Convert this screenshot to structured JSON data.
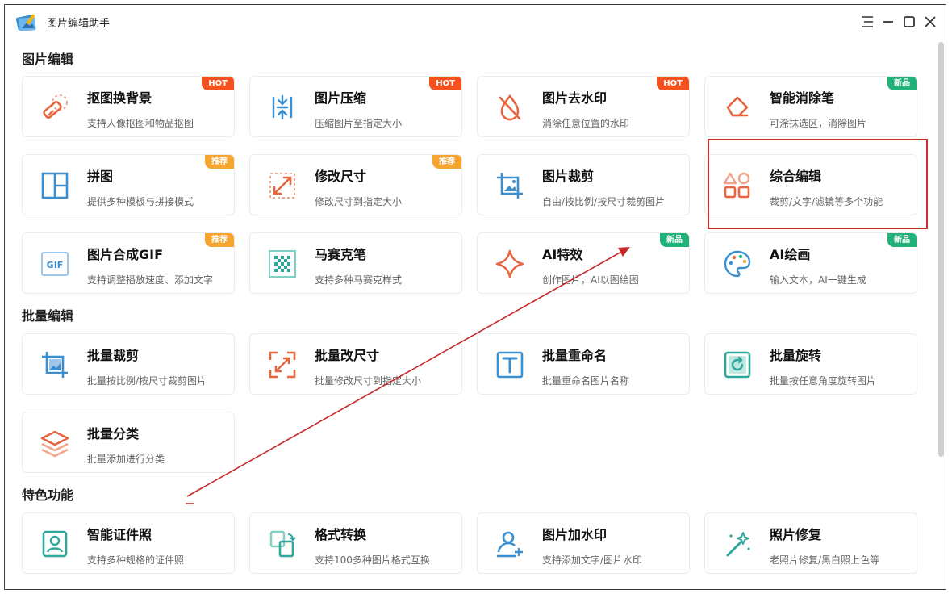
{
  "app": {
    "title": "图片编辑助手",
    "colors": {
      "hot": "#f4511e",
      "recommend": "#f6a531",
      "new": "#21b27a",
      "icon_orange": "#e8663f",
      "icon_blue": "#3a8fd0"
    }
  },
  "sections": {
    "edit": "图片编辑",
    "batch": "批量编辑",
    "feature": "特色功能"
  },
  "cards": [
    {
      "title": "抠图换背景",
      "desc": "支持人像抠图和物品抠图",
      "badge": "HOT",
      "icon": "eraser-icon"
    },
    {
      "title": "图片压缩",
      "desc": "压缩图片至指定大小",
      "badge": "HOT",
      "icon": "compress-icon"
    },
    {
      "title": "图片去水印",
      "desc": "消除任意位置的水印",
      "badge": "HOT",
      "icon": "droplet-off-icon"
    },
    {
      "title": "智能消除笔",
      "desc": "可涂抹选区，消除图片",
      "badge": "新品",
      "icon": "eraser-pen-icon"
    },
    {
      "title": "拼图",
      "desc": "提供多种模板与拼接模式",
      "badge": "推荐",
      "icon": "collage-icon"
    },
    {
      "title": "修改尺寸",
      "desc": "修改尺寸到指定大小",
      "badge": "推荐",
      "icon": "resize-icon"
    },
    {
      "title": "图片裁剪",
      "desc": "自由/按比例/按尺寸裁剪图片",
      "badge": "",
      "icon": "crop-icon"
    },
    {
      "title": "综合编辑",
      "desc": "裁剪/文字/滤镜等多个功能",
      "badge": "",
      "icon": "shapes-icon"
    },
    {
      "title": "图片合成GIF",
      "desc": "支持调整播放速度、添加文字",
      "badge": "推荐",
      "icon": "gif-icon"
    },
    {
      "title": "马赛克笔",
      "desc": "支持多种马赛克样式",
      "badge": "",
      "icon": "mosaic-icon"
    },
    {
      "title": "AI特效",
      "desc": "创作图片，AI以图绘图",
      "badge": "新品",
      "icon": "sparkle-icon"
    },
    {
      "title": "AI绘画",
      "desc": "输入文本，AI一键生成",
      "badge": "新品",
      "icon": "palette-icon"
    },
    {
      "title": "批量裁剪",
      "desc": "批量按比例/按尺寸裁剪图片",
      "badge": "",
      "icon": "batch-crop-icon"
    },
    {
      "title": "批量改尺寸",
      "desc": "批量修改尺寸到指定大小",
      "badge": "",
      "icon": "batch-resize-icon"
    },
    {
      "title": "批量重命名",
      "desc": "批量重命名图片名称",
      "badge": "",
      "icon": "text-rename-icon"
    },
    {
      "title": "批量旋转",
      "desc": "批量按任意角度旋转图片",
      "badge": "",
      "icon": "rotate-icon"
    },
    {
      "title": "批量分类",
      "desc": "批量添加进行分类",
      "badge": "",
      "icon": "layers-icon"
    },
    {
      "title": "智能证件照",
      "desc": "支持多种规格的证件照",
      "badge": "",
      "icon": "id-photo-icon"
    },
    {
      "title": "格式转换",
      "desc": "支持100多种图片格式互换",
      "badge": "",
      "icon": "convert-icon"
    },
    {
      "title": "图片加水印",
      "desc": "支持添加文字/图片水印",
      "badge": "",
      "icon": "add-watermark-icon"
    },
    {
      "title": "照片修复",
      "desc": "老照片修复/黑白照上色等",
      "badge": "",
      "icon": "magic-wand-icon"
    }
  ]
}
